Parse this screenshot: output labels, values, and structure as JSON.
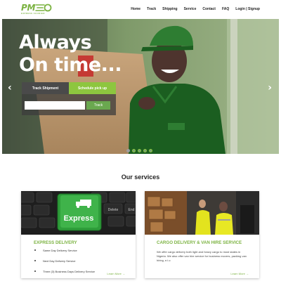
{
  "header": {
    "logo_text": "PM",
    "logo_sub": "EXPRESS COURIER",
    "nav": [
      "Home",
      "Track",
      "Shipping",
      "Service",
      "Contact",
      "FAQ",
      "Login | Signup"
    ]
  },
  "hero": {
    "headline_line1": "Always",
    "headline_line2": "On time...",
    "tab_track": "Track Shipment",
    "tab_schedule": "Schedule pick up",
    "track_input_value": "",
    "track_button": "Track",
    "arrow_left": "‹",
    "arrow_right": "›",
    "carousel": {
      "slide_count": 5,
      "active_index": 0
    }
  },
  "services": {
    "title": "Our services",
    "cards": [
      {
        "title": "EXPRESS DELIVERY",
        "image_label": "Express",
        "items": [
          "Same Day Delivery Service",
          "Next Day Delivery Service",
          "Three (3) Business  Days Delivery Service"
        ],
        "learn_more": "Learn More →"
      },
      {
        "title": "CARGO DELIVERY & VAN HIRE SERVICE",
        "text": "We offer cargo delivery both light and heavy cargo to most states in Nigeria. We also offer van hire service for business movers, packing van hiring, e.t.c",
        "learn_more": "Learn More →"
      }
    ]
  },
  "colors": {
    "brand_green": "#7cb342",
    "accent_green": "#8dc63f"
  }
}
